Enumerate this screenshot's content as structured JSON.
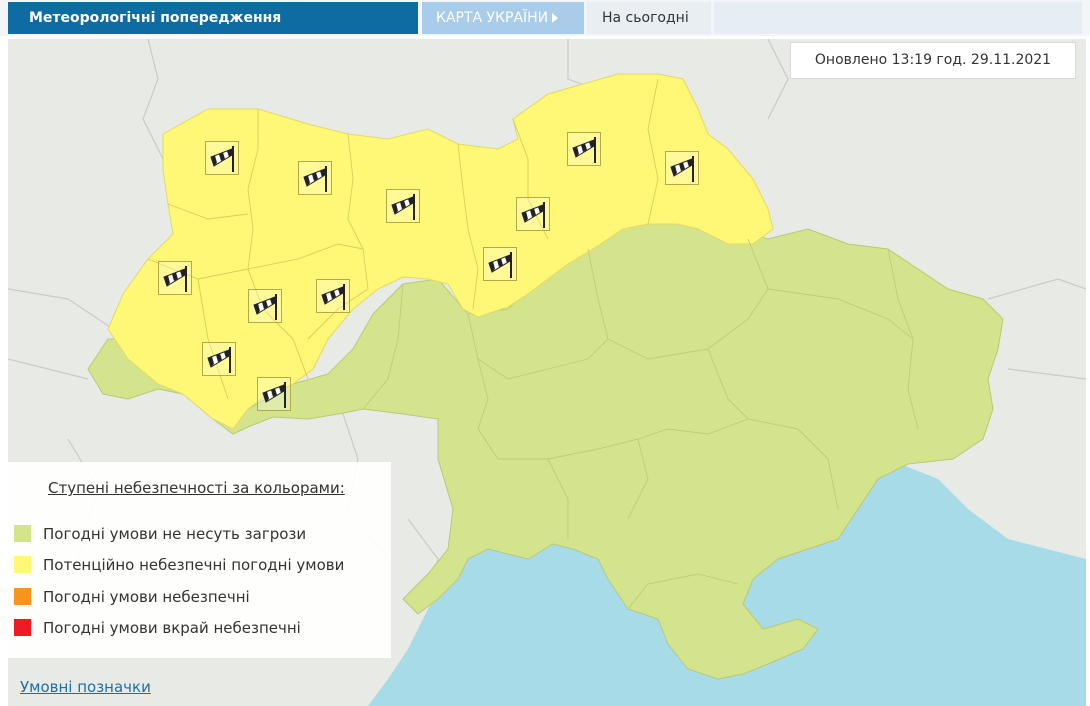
{
  "header": {
    "title": "Метеорологічні попередження",
    "map_tab": "КАРТА УКРАЇНИ",
    "today_tab": "На сьогодні"
  },
  "updated": "Оновлено 13:19 год. 29.11.2021",
  "legend": {
    "title": "Ступені небезпечності за кольорами:",
    "items": [
      {
        "label": "Погодні умови не несуть загрози",
        "color": "#d4e48c"
      },
      {
        "label": "Потенційно небезпечні погодні умови",
        "color": "#fff776"
      },
      {
        "label": "Погодні умови небезпечні",
        "color": "#f7941d"
      },
      {
        "label": "Погодні умови вкрай небезпечні",
        "color": "#ed1c24"
      }
    ]
  },
  "footer_link": "Умовні позначки",
  "map": {
    "warning_icon": "windsock-icon",
    "colors": {
      "land_safe": "#d4e48c",
      "land_warning": "#fff776",
      "sea": "#a8dbe8",
      "outside": "#e8ebe5"
    }
  }
}
